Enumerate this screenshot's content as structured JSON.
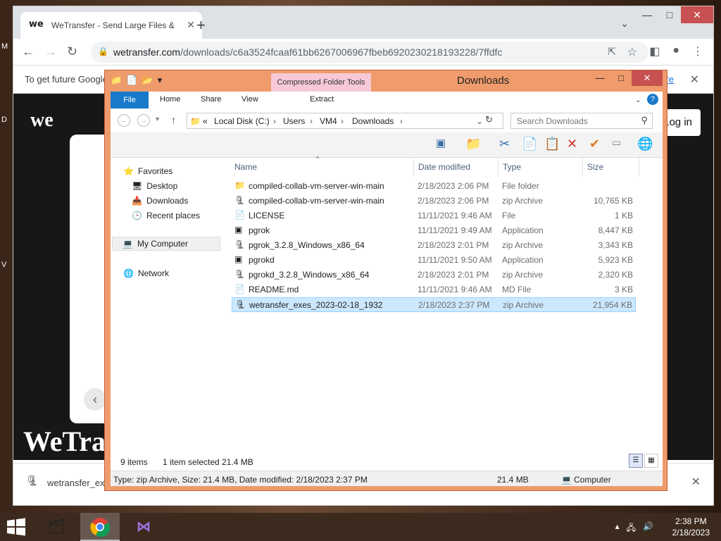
{
  "desktop": {
    "labels": [
      "M",
      "D",
      "V"
    ]
  },
  "chrome": {
    "tab_favicon": "we",
    "tab_title": "WeTransfer - Send Large Files &",
    "url_host": "wetransfer.com",
    "url_path": "/downloads/c6a3524fcaaf61bb6267006967fbeb6920230218193228/7ffdfc",
    "infobar_text": "To get future Google",
    "infobar_link": "re",
    "page_logo": "we",
    "page_big_text": "WeTra",
    "login_label": "Log in",
    "download_name": "wetransfer_exe"
  },
  "explorer": {
    "context_tab": "Compressed Folder Tools",
    "title": "Downloads",
    "tabs": {
      "file": "File",
      "home": "Home",
      "share": "Share",
      "view": "View",
      "extract": "Extract",
      "help": "?"
    },
    "path": {
      "prefix": "«",
      "parts": [
        "Local Disk (C:)",
        "Users",
        "VM4",
        "Downloads"
      ]
    },
    "search_placeholder": "Search Downloads",
    "nav": {
      "favorites": "Favorites",
      "desktop": "Desktop",
      "downloads": "Downloads",
      "recent": "Recent places",
      "computer": "My Computer",
      "network": "Network"
    },
    "columns": {
      "name": "Name",
      "date": "Date modified",
      "type": "Type",
      "size": "Size"
    },
    "files": [
      {
        "name": "compiled-collab-vm-server-win-main",
        "date": "2/18/2023 2:06 PM",
        "type": "File folder",
        "size": "",
        "icon": "folder-icon"
      },
      {
        "name": "compiled-collab-vm-server-win-main",
        "date": "2/18/2023 2:06 PM",
        "type": "zip Archive",
        "size": "10,765 KB",
        "icon": "zip-icon"
      },
      {
        "name": "LICENSE",
        "date": "11/11/2021 9:46 AM",
        "type": "File",
        "size": "1 KB",
        "icon": "file-icon"
      },
      {
        "name": "pgrok",
        "date": "11/11/2021 9:49 AM",
        "type": "Application",
        "size": "8,447 KB",
        "icon": "app-icon"
      },
      {
        "name": "pgrok_3.2.8_Windows_x86_64",
        "date": "2/18/2023 2:01 PM",
        "type": "zip Archive",
        "size": "3,343 KB",
        "icon": "zip-icon"
      },
      {
        "name": "pgrokd",
        "date": "11/11/2021 9:50 AM",
        "type": "Application",
        "size": "5,923 KB",
        "icon": "app-icon"
      },
      {
        "name": "pgrokd_3.2.8_Windows_x86_64",
        "date": "2/18/2023 2:01 PM",
        "type": "zip Archive",
        "size": "2,320 KB",
        "icon": "zip-icon"
      },
      {
        "name": "README.md",
        "date": "11/11/2021 9:46 AM",
        "type": "MD File",
        "size": "3 KB",
        "icon": "file-icon"
      },
      {
        "name": "wetransfer_exes_2023-02-18_1932",
        "date": "2/18/2023 2:37 PM",
        "type": "zip Archive",
        "size": "21,954 KB",
        "icon": "zip-icon",
        "selected": true
      }
    ],
    "status": {
      "count": "9 items",
      "selection": "1 item selected  21.4 MB"
    },
    "details": {
      "summary": "Type: zip Archive, Size: 21.4 MB, Date modified: 2/18/2023 2:37 PM",
      "size": "21.4 MB",
      "location": "Computer"
    }
  },
  "taskbar": {
    "time": "2:38 PM",
    "date": "2/18/2023"
  }
}
